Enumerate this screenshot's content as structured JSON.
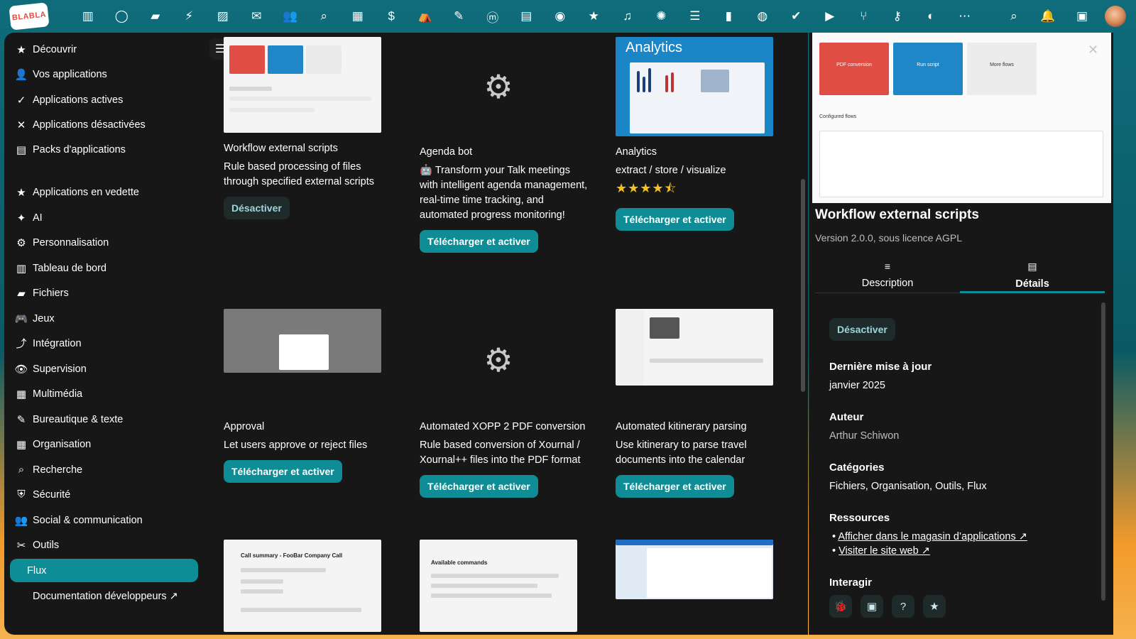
{
  "logo_text": "BLABLA",
  "top_icons": [
    "dashboard",
    "talk",
    "files",
    "activity",
    "photos",
    "mail",
    "contacts",
    "search",
    "calendar",
    "money",
    "deck",
    "notes",
    "mastodon",
    "archive",
    "github",
    "favorites",
    "music",
    "magic",
    "list",
    "analytics",
    "globe",
    "tasks",
    "video",
    "food",
    "keys",
    "cc",
    "more"
  ],
  "top_right_icons": [
    "search",
    "bell",
    "contacts-menu"
  ],
  "sidebar": {
    "items": [
      {
        "label": "Découvrir",
        "icon": "★"
      },
      {
        "label": "Vos applications",
        "icon": "👤"
      },
      {
        "label": "Applications actives",
        "icon": "✓"
      },
      {
        "label": "Applications désactivées",
        "icon": "✕"
      },
      {
        "label": "Packs d'applications",
        "icon": "▤"
      },
      {
        "label": "Applications en vedette",
        "icon": "★"
      },
      {
        "label": "AI",
        "icon": "✦"
      },
      {
        "label": "Personnalisation",
        "icon": "⚙"
      },
      {
        "label": "Tableau de bord",
        "icon": "▥"
      },
      {
        "label": "Fichiers",
        "icon": "▰"
      },
      {
        "label": "Jeux",
        "icon": "🎮"
      },
      {
        "label": "Intégration",
        "icon": "⤴"
      },
      {
        "label": "Supervision",
        "icon": "👁"
      },
      {
        "label": "Multimédia",
        "icon": "▦"
      },
      {
        "label": "Bureautique & texte",
        "icon": "✎"
      },
      {
        "label": "Organisation",
        "icon": "▦"
      },
      {
        "label": "Recherche",
        "icon": "⌕"
      },
      {
        "label": "Sécurité",
        "icon": "⛨"
      },
      {
        "label": "Social & communication",
        "icon": "👥"
      },
      {
        "label": "Outils",
        "icon": "✂"
      },
      {
        "label": "Flux",
        "icon": ""
      },
      {
        "label": "Documentation développeurs ↗",
        "icon": ""
      }
    ]
  },
  "cards": [
    {
      "title": "Workflow external scripts",
      "desc": "Rule based processing of files through specified external scripts",
      "button": "Désactiver"
    },
    {
      "title": "Agenda bot",
      "desc": "🤖 Transform your Talk meetings with intelligent agenda management, real-time time tracking, and automated progress monitoring!",
      "button": "Télécharger et activer"
    },
    {
      "title": "Analytics",
      "desc": "extract / store / visualize",
      "rating": 4.5,
      "button": "Télécharger et activer",
      "thumb_title": "Analytics"
    },
    {
      "title": "Approval",
      "desc": "Let users approve or reject files",
      "button": "Télécharger et activer"
    },
    {
      "title": "Automated XOPP 2 PDF conversion",
      "desc": "Rule based conversion of Xournal / Xournal++ files into the PDF format",
      "button": "Télécharger et activer"
    },
    {
      "title": "Automated kitinerary parsing",
      "desc": "Use kitinerary to parse travel documents into the calendar",
      "button": "Télécharger et activer"
    }
  ],
  "card_previews": {
    "call_summary_title": "Call summary - FooBar Company Call",
    "commands_title": "Available commands"
  },
  "panel": {
    "preview": {
      "tile1": "PDF conversion",
      "tile2": "Run script",
      "tile3": "More flows",
      "configured": "Configured flows"
    },
    "title": "Workflow external scripts",
    "version": "Version 2.0.0, sous licence AGPL",
    "tabs": [
      {
        "label": "Description",
        "icon": "≡"
      },
      {
        "label": "Détails",
        "icon": "▤"
      }
    ],
    "disable_button": "Désactiver",
    "last_update_label": "Dernière mise à jour",
    "last_update_value": "janvier 2025",
    "author_label": "Auteur",
    "author_value": "Arthur Schiwon",
    "categories_label": "Catégories",
    "categories_value": "Fichiers, Organisation, Outils, Flux",
    "resources_label": "Ressources",
    "resources": [
      "Afficher dans le magasin d’applications ↗",
      "Visiter le site web ↗"
    ],
    "interact_label": "Interagir"
  },
  "colors": {
    "accent": "#0f8d97",
    "bg": "#171717",
    "star": "#f4c21e"
  }
}
